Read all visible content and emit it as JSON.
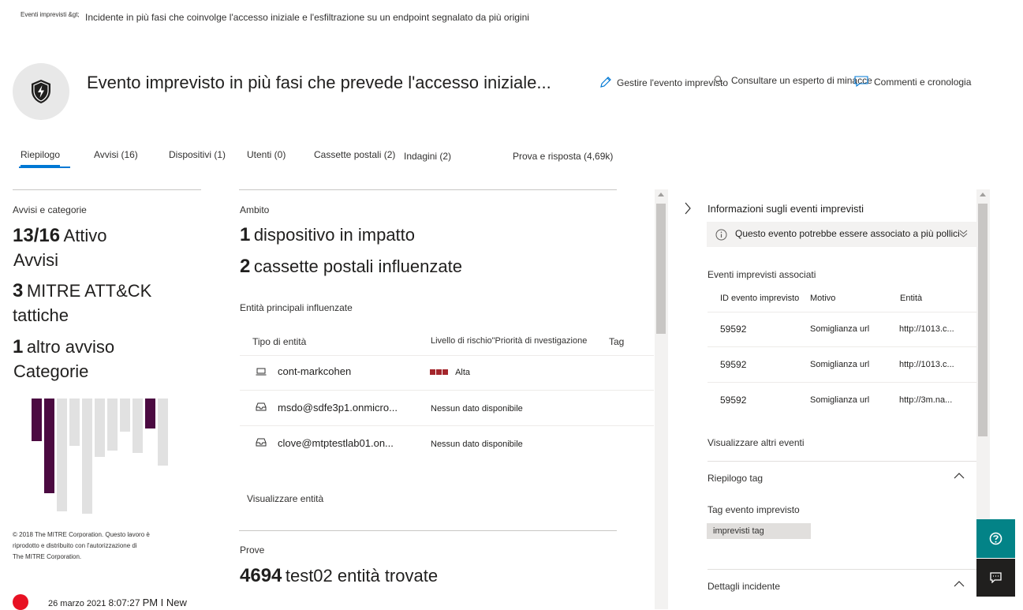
{
  "breadcrumb": {
    "parent": "Eventi imprevisti &gt;",
    "current": "Incidente in più fasi che coinvolge l'accesso iniziale e l'esfiltrazione su un endpoint segnalato da più origini"
  },
  "header": {
    "title": "Evento imprevisto in più fasi che prevede l'accesso iniziale...",
    "actions": {
      "manage": "Gestire l'evento imprevisto",
      "expert": "Consultare un esperto di minacce",
      "comments": "Commenti e cronologia"
    }
  },
  "tabs": [
    {
      "label": "Riepilogo",
      "active": true
    },
    {
      "label": "Avvisi (16)"
    },
    {
      "label": "Dispositivi (1)"
    },
    {
      "label": "Utenti (0)"
    },
    {
      "label": "Cassette postali (2)"
    },
    {
      "label": "Indagini (2)"
    },
    {
      "label": "Prova e risposta (4,69k)"
    }
  ],
  "left": {
    "section_title": "Avvisi e categorie",
    "alerts_num": "13/16",
    "alerts_txt": "Attivo",
    "alerts_line2": "Avvisi",
    "mitre_num": "3",
    "mitre_txt": "MITRE ATT&CK",
    "mitre_line2": "tattiche",
    "other_num": "1",
    "other_txt": "altro avviso",
    "other_line2": "Categorie",
    "copyright_1": "© 2018 The MITRE Corporation. Questo lavoro è",
    "copyright_2": "riprodotto e distribuito con l'autorizzazione di",
    "copyright_3": "The MITRE Corporation.",
    "footer_date": "26 marzo 2021",
    "footer_time": "8:07:27",
    "footer_status": "PM I New",
    "mitre_bars": [
      {
        "dark": true,
        "height": 0.36
      },
      {
        "dark": true,
        "height": 0.8
      },
      {
        "dark": false,
        "height": 0.95
      },
      {
        "dark": false,
        "height": 0.4
      },
      {
        "dark": false,
        "height": 0.97
      },
      {
        "dark": false,
        "height": 0.49
      },
      {
        "dark": false,
        "height": 0.44
      },
      {
        "dark": false,
        "height": 0.28
      },
      {
        "dark": false,
        "height": 0.46
      },
      {
        "dark": true,
        "height": 0.25
      },
      {
        "dark": false,
        "height": 0.57
      }
    ],
    "colors": {
      "dark": "#4b0a41",
      "light": "#e1e1e1"
    }
  },
  "middle": {
    "scope_title": "Ambito",
    "devices_num": "1",
    "devices_txt": "dispositivo in impatto",
    "mailboxes_num": "2",
    "mailboxes_txt": "cassette postali influenzate",
    "entities_title": "Entità principali influenzate",
    "col_type": "Tipo di entità",
    "col_risk": "Livello di rischio\"Priorità di nvestigazione",
    "col_tag": "Tag",
    "rows": [
      {
        "icon": "laptop-icon",
        "name": "cont-markcohen",
        "risk": "Alta",
        "risk_color": "#a4262c"
      },
      {
        "icon": "mailbox-icon",
        "name": "msdo@sdfe3p1.onmicro...",
        "risk": "Nessun dato disponibile"
      },
      {
        "icon": "mailbox-icon",
        "name": "clove@mtptestlab01.on...",
        "risk": "Nessun dato disponibile"
      }
    ],
    "view_entities": "Visualizzare entità",
    "evidence_title": "Prove",
    "evidence_num": "4694",
    "evidence_txt": "test02 entità trovate"
  },
  "right": {
    "panel_title": "Informazioni sugli eventi imprevisti",
    "info_banner": "Questo evento potrebbe essere associato a più pollici",
    "associated_title": "Eventi imprevisti associati",
    "col_id": "ID evento imprevisto",
    "col_reason": "Motivo",
    "col_entity": "Entità",
    "rows": [
      {
        "id": "59592",
        "reason": "Somiglianza url",
        "entity": "http://1013.c..."
      },
      {
        "id": "59592",
        "reason": "Somiglianza url",
        "entity": "http://1013.c..."
      },
      {
        "id": "59592",
        "reason": "Somiglianza url",
        "entity": "http://3m.na..."
      }
    ],
    "view_more": "Visualizzare altri eventi",
    "tag_summary": "Riepilogo tag",
    "tag_label": "Tag evento imprevisto",
    "tag_chip": "imprevisti tag",
    "incident_details": "Dettagli incidente"
  }
}
